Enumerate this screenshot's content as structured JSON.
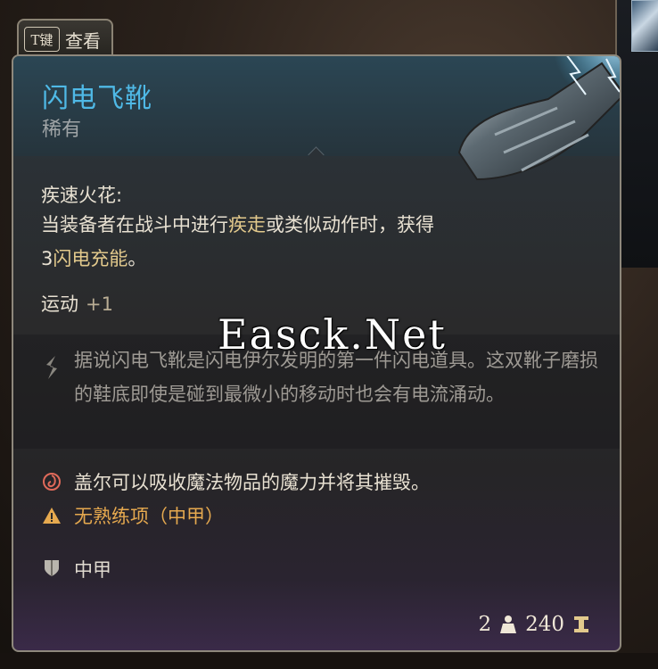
{
  "tab": {
    "key": "T键",
    "label": "查看"
  },
  "item": {
    "name": "闪电飞靴",
    "rarity": "稀有",
    "ability": {
      "title": "疾速火花:",
      "desc_part1": "当装备者在战斗中进行",
      "desc_hl1": "疾走",
      "desc_part2": "或类似动作时，获得3",
      "desc_hl2": "闪电充能",
      "desc_part3": "。"
    },
    "stat": {
      "name": "运动",
      "bonus": "+1"
    },
    "lore": "据说闪电飞靴是闪电伊尔发明的第一件闪电道具。这双靴子磨损的鞋底即使是碰到最微小的移动时也会有电流涌动。",
    "note": "盖尔可以吸收魔法物品的魔力并将其摧毁。",
    "warning": "无熟练项（中甲）",
    "armor_type": "中甲",
    "weight": "2",
    "price": "240"
  },
  "watermark": "Easck.Net",
  "colors": {
    "name": "#4fb9e6",
    "warning": "#e6a94f",
    "highlight": "#e2c98c"
  },
  "icons": [
    "feather-icon",
    "gale-icon",
    "warning-icon",
    "shield-icon",
    "weight-icon",
    "gold-icon"
  ]
}
